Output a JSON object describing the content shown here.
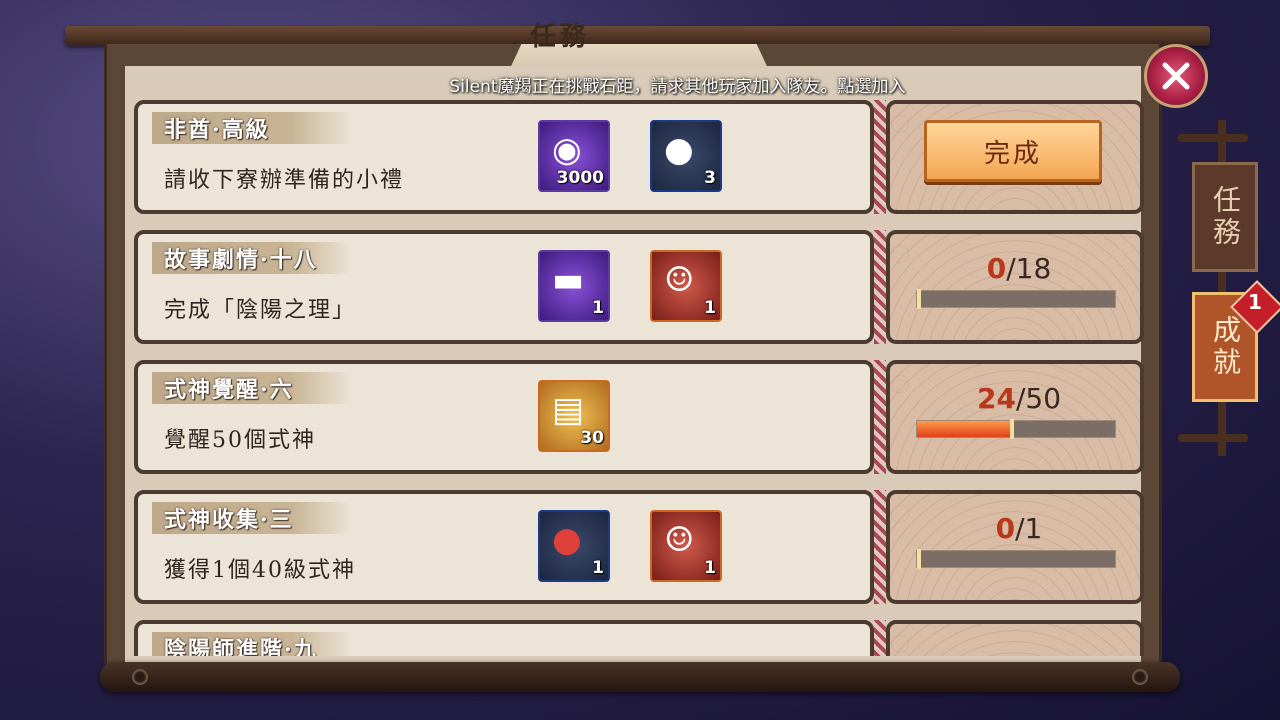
{
  "window": {
    "title": "任務"
  },
  "marquee": "Silent魔羯正在挑戰石距，請求其他玩家加入隊友。點選加入",
  "side_tabs": [
    {
      "label": "任務",
      "active": false
    },
    {
      "label": "成就",
      "active": true,
      "badge": "1"
    }
  ],
  "close_icon": "close-icon",
  "tasks": [
    {
      "title": "非酋·高級",
      "desc": "請收下寮辦準備的小禮",
      "rewards": [
        {
          "icon": "magatama-icon",
          "count": "3000",
          "rarity": "purple"
        },
        {
          "icon": "daruma-material-icon",
          "count": "3",
          "rarity": "blue"
        }
      ],
      "action": {
        "type": "button",
        "label": "完成"
      }
    },
    {
      "title": "故事劇情·十八",
      "desc": "完成「陰陽之理」",
      "rewards": [
        {
          "icon": "ticket-icon",
          "count": "1",
          "rarity": "purple"
        },
        {
          "icon": "shikigami-portrait-icon",
          "count": "1",
          "rarity": "red"
        }
      ],
      "action": {
        "type": "progress",
        "current": "0",
        "total": "/18",
        "fraction": 0.0
      }
    },
    {
      "title": "式神覺醒·六",
      "desc": "覺醒50個式神",
      "rewards": [
        {
          "icon": "skin-scroll-icon",
          "count": "30",
          "rarity": "gold"
        }
      ],
      "action": {
        "type": "progress",
        "current": "24",
        "total": "/50",
        "fraction": 0.48
      }
    },
    {
      "title": "式神收集·三",
      "desc": "獲得1個40級式神",
      "rewards": [
        {
          "icon": "red-daruma-icon",
          "count": "1",
          "rarity": "blue"
        },
        {
          "icon": "shikigami-portrait-icon",
          "count": "1",
          "rarity": "red"
        }
      ],
      "action": {
        "type": "progress",
        "current": "0",
        "total": "/1",
        "fraction": 0.0
      }
    },
    {
      "title": "陰陽師進階·九",
      "desc": "",
      "rewards": [],
      "action": {
        "type": "progress",
        "current": "",
        "total": "",
        "fraction": 0.0
      }
    }
  ]
}
